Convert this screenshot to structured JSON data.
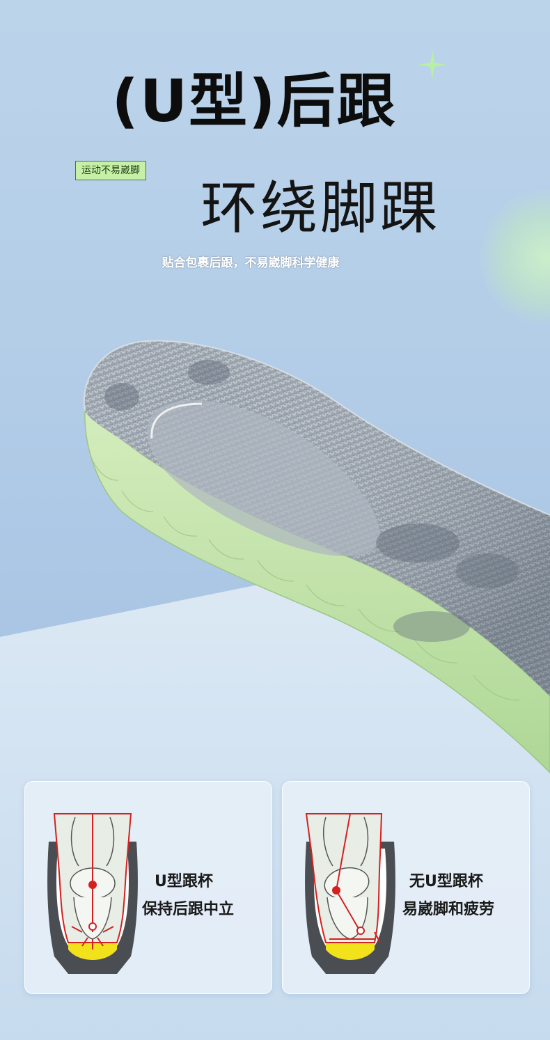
{
  "header": {
    "title": "(U型)后跟",
    "tag": "运动不易崴脚",
    "subtitle": "环绕脚踝",
    "description": "贴合包裹后跟，不易崴脚科学健康"
  },
  "comparison": {
    "with_u": {
      "line1": "U型跟杯",
      "line2": "保持后跟中立"
    },
    "without_u": {
      "line1": "无U型跟杯",
      "line2": "易崴脚和疲劳"
    }
  },
  "colors": {
    "background_blue": "#b3cde8",
    "accent_green": "#c6f0a6",
    "insole_grey": "#8d97a2",
    "foam_green": "#bfe2a6",
    "arrow_red": "#d42020",
    "heel_yellow": "#f2e21c"
  }
}
